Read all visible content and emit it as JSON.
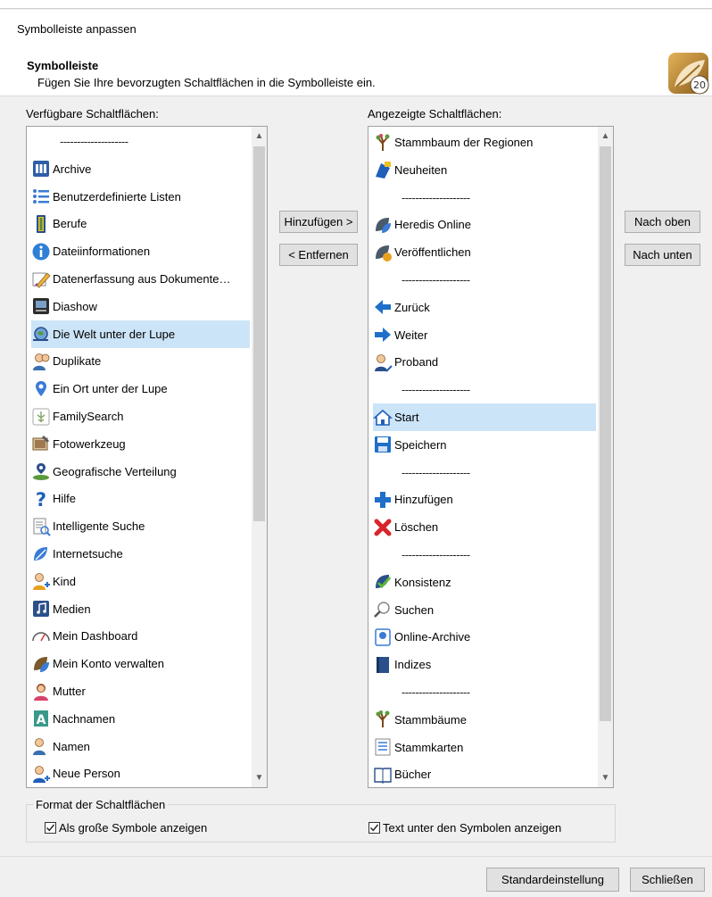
{
  "dialog": {
    "title": "Symbolleiste anpassen",
    "section_title": "Symbolleiste",
    "section_desc": "Fügen Sie Ihre bevorzugten Schaltflächen in die Symbolleiste ein.",
    "logo_text": "20"
  },
  "available": {
    "label": "Verfügbare Schaltflächen:",
    "selected_index": 7,
    "items": [
      {
        "label": "--------------------",
        "icon": "separator"
      },
      {
        "label": "Archive",
        "icon": "archive-icon"
      },
      {
        "label": "Benutzerdefinierte Listen",
        "icon": "list-icon"
      },
      {
        "label": "Berufe",
        "icon": "profession-icon"
      },
      {
        "label": "Dateiinformationen",
        "icon": "info-icon"
      },
      {
        "label": "Datenerfassung aus Dokumente…",
        "icon": "pen-icon"
      },
      {
        "label": "Diashow",
        "icon": "slideshow-icon"
      },
      {
        "label": "Die Welt unter der Lupe",
        "icon": "world-magnifier-icon"
      },
      {
        "label": "Duplikate",
        "icon": "duplicates-icon"
      },
      {
        "label": "Ein Ort unter der Lupe",
        "icon": "place-pin-icon"
      },
      {
        "label": "FamilySearch",
        "icon": "familysearch-icon"
      },
      {
        "label": "Fotowerkzeug",
        "icon": "photo-tool-icon"
      },
      {
        "label": "Geografische Verteilung",
        "icon": "geo-distribution-icon"
      },
      {
        "label": "Hilfe",
        "icon": "help-icon"
      },
      {
        "label": "Intelligente Suche",
        "icon": "smart-search-icon"
      },
      {
        "label": "Internetsuche",
        "icon": "internet-search-icon"
      },
      {
        "label": "Kind",
        "icon": "child-icon"
      },
      {
        "label": "Medien",
        "icon": "media-icon"
      },
      {
        "label": "Mein Dashboard",
        "icon": "dashboard-icon"
      },
      {
        "label": "Mein Konto verwalten",
        "icon": "account-icon"
      },
      {
        "label": "Mutter",
        "icon": "mother-icon"
      },
      {
        "label": "Nachnamen",
        "icon": "surnames-icon"
      },
      {
        "label": "Namen",
        "icon": "names-icon"
      },
      {
        "label": "Neue Person",
        "icon": "new-person-icon"
      }
    ]
  },
  "displayed": {
    "label": "Angezeigte Schaltflächen:",
    "selected_index": 10,
    "items": [
      {
        "label": "Stammbaum der Regionen",
        "icon": "region-tree-icon"
      },
      {
        "label": "Neuheiten",
        "icon": "news-icon"
      },
      {
        "label": "--------------------",
        "icon": "separator"
      },
      {
        "label": "Heredis Online",
        "icon": "heredis-online-icon"
      },
      {
        "label": "Veröffentlichen",
        "icon": "publish-icon"
      },
      {
        "label": "--------------------",
        "icon": "separator"
      },
      {
        "label": "Zurück",
        "icon": "back-arrow-icon"
      },
      {
        "label": "Weiter",
        "icon": "forward-arrow-icon"
      },
      {
        "label": "Proband",
        "icon": "proband-icon"
      },
      {
        "label": "--------------------",
        "icon": "separator"
      },
      {
        "label": "Start",
        "icon": "home-icon"
      },
      {
        "label": "Speichern",
        "icon": "save-icon"
      },
      {
        "label": "--------------------",
        "icon": "separator"
      },
      {
        "label": "Hinzufügen",
        "icon": "add-plus-icon"
      },
      {
        "label": "Löschen",
        "icon": "delete-x-icon"
      },
      {
        "label": "--------------------",
        "icon": "separator"
      },
      {
        "label": "Konsistenz",
        "icon": "consistency-check-icon"
      },
      {
        "label": "Suchen",
        "icon": "search-icon"
      },
      {
        "label": "Online-Archive",
        "icon": "online-archive-icon"
      },
      {
        "label": "Indizes",
        "icon": "index-book-icon"
      },
      {
        "label": "--------------------",
        "icon": "separator"
      },
      {
        "label": "Stammbäume",
        "icon": "family-tree-icon"
      },
      {
        "label": "Stammkarten",
        "icon": "family-card-icon"
      },
      {
        "label": "Bücher",
        "icon": "books-icon"
      }
    ]
  },
  "buttons": {
    "add": "Hinzufügen >",
    "remove": "< Entfernen",
    "up": "Nach oben",
    "down": "Nach unten",
    "default": "Standardeinstellung",
    "close": "Schließen"
  },
  "format": {
    "group_title": "Format der Schaltflächen",
    "large_icons": {
      "label": "Als große Symbole anzeigen",
      "checked": true
    },
    "text_below": {
      "label": "Text unter den Symbolen anzeigen",
      "checked": true
    }
  },
  "colors": {
    "selection": "#cce4f7",
    "window_bg": "#f0f0f0"
  }
}
